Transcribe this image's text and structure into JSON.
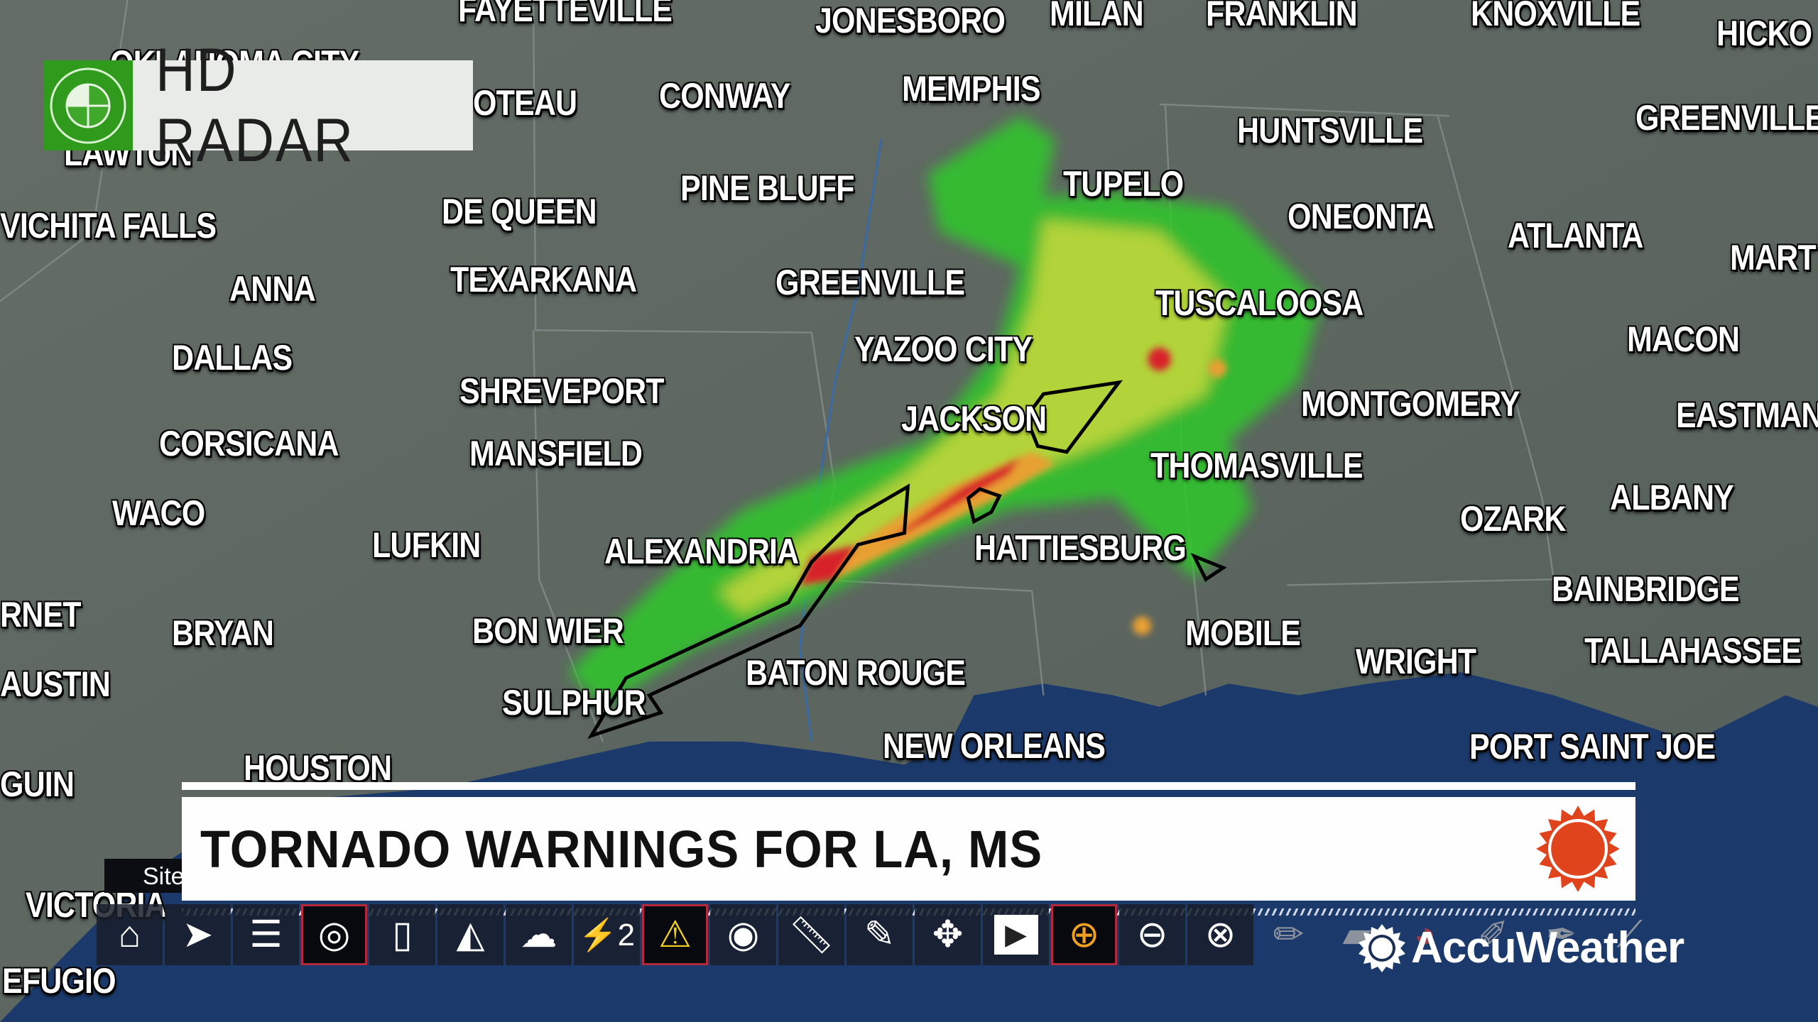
{
  "header": {
    "title": "HD RADAR",
    "icon": "radar-scope-icon",
    "accent": "#2f9a1c"
  },
  "banner": {
    "headline": "TORNADO WARNINGS FOR LA, MS",
    "logo": "accuweather-sun-icon",
    "logo_color": "#e0441c"
  },
  "site_label": "Site",
  "brand": {
    "name": "AccuWeather"
  },
  "map": {
    "cities": [
      "FAYETTEVILLE",
      "JONESBORO",
      "MILAN",
      "FRANKLIN",
      "KNOXVILLE",
      "HICKO",
      "OKLAHOMA CITY",
      "OTEAU",
      "CONWAY",
      "MEMPHIS",
      "LAWTON",
      "HUNTSVILLE",
      "GREENVILLE",
      "PINE BLUFF",
      "TUPELO",
      "VICHITA FALLS",
      "DE QUEEN",
      "ONEONTA",
      "ATLANTA",
      "MART",
      "ANNA",
      "TEXARKANA",
      "GREENVILLE",
      "TUSCALOOSA",
      "MACON",
      "DALLAS",
      "YAZOO CITY",
      "SHREVEPORT",
      "MONTGOMERY",
      "EASTMAN",
      "JACKSON",
      "CORSICANA",
      "MANSFIELD",
      "THOMASVILLE",
      "ALBANY",
      "WACO",
      "OZARK",
      "LUFKIN",
      "ALEXANDRIA",
      "HATTIESBURG",
      "BAINBRIDGE",
      "RNET",
      "BRYAN",
      "BON WIER",
      "MOBILE",
      "TALLAHASSEE",
      "WRIGHT",
      "AUSTIN",
      "BATON ROUGE",
      "SULPHUR",
      "NEW ORLEANS",
      "PORT SAINT JOE",
      "GUIN",
      "HOUSTON",
      "VICTORIA",
      "EFUGIO"
    ],
    "colors": {
      "land": "#5d6660",
      "water": "#1b3a6b",
      "radar_light": "#2ec82a",
      "radar_mid": "#e8e43a",
      "radar_heavy": "#d8202a",
      "warning_outline": "#000000"
    }
  },
  "toolbar": {
    "items": [
      "home-icon",
      "location-arrow-icon",
      "layers-icon",
      "radar-icon",
      "device-icon",
      "cone-icon",
      "lightning-cloud-icon",
      "split-screen-icon",
      "warning-icon",
      "eye-icon",
      "ruler-icon",
      "eyedropper-icon",
      "pan-icon",
      "play-icon",
      "zoom-in-icon",
      "minus-icon",
      "close-icon",
      "pencil-icon",
      "eraser-icon",
      "color-picker-icon",
      "marker-icon",
      "pen-icon",
      "line-icon"
    ],
    "labels": {
      "split": "2",
      "warning": "!"
    }
  }
}
